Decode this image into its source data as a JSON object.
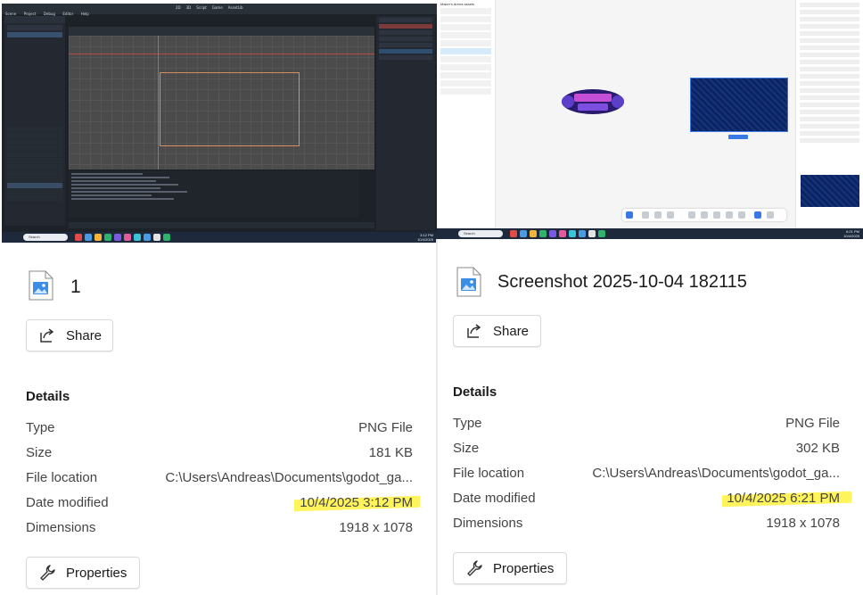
{
  "left": {
    "thumbnail": {
      "app_title": "MainMenu.tscn - Maker's Arena - Godot Engine",
      "menus": [
        "Scene",
        "Project",
        "Debug",
        "Editor",
        "Help"
      ],
      "workspace_tabs": [
        "2D",
        "3D",
        "Script",
        "Game",
        "AssetLib"
      ],
      "clock_time": "3:12 PM",
      "clock_date": "10/4/2025",
      "search_placeholder": "Search"
    },
    "file_name": "1",
    "share_label": "Share",
    "details_heading": "Details",
    "details": [
      {
        "key": "Type",
        "value": "PNG File"
      },
      {
        "key": "Size",
        "value": "181 KB"
      },
      {
        "key": "File location",
        "value": "C:\\Users\\Andreas\\Documents\\godot_ga..."
      },
      {
        "key": "Date modified",
        "value": "10/4/2025 3:12 PM"
      },
      {
        "key": "Dimensions",
        "value": "1918 x 1078"
      }
    ],
    "properties_label": "Properties"
  },
  "right": {
    "thumbnail": {
      "file_title": "Maker's Arena assets",
      "clock_time": "6:21 PM",
      "clock_date": "10/4/2025",
      "search_placeholder": "Search"
    },
    "file_name": "Screenshot 2025-10-04 182115",
    "share_label": "Share",
    "details_heading": "Details",
    "details": [
      {
        "key": "Type",
        "value": "PNG File"
      },
      {
        "key": "Size",
        "value": "302 KB"
      },
      {
        "key": "File location",
        "value": "C:\\Users\\Andreas\\Documents\\godot_ga..."
      },
      {
        "key": "Date modified",
        "value": "10/4/2025 6:21 PM"
      },
      {
        "key": "Dimensions",
        "value": "1918 x 1078"
      }
    ],
    "properties_label": "Properties"
  },
  "colors": {
    "highlight": "#fff45c",
    "accent": "#0067c0",
    "godot_bg": "#1d2229",
    "figma_panel": "#0c2460"
  }
}
